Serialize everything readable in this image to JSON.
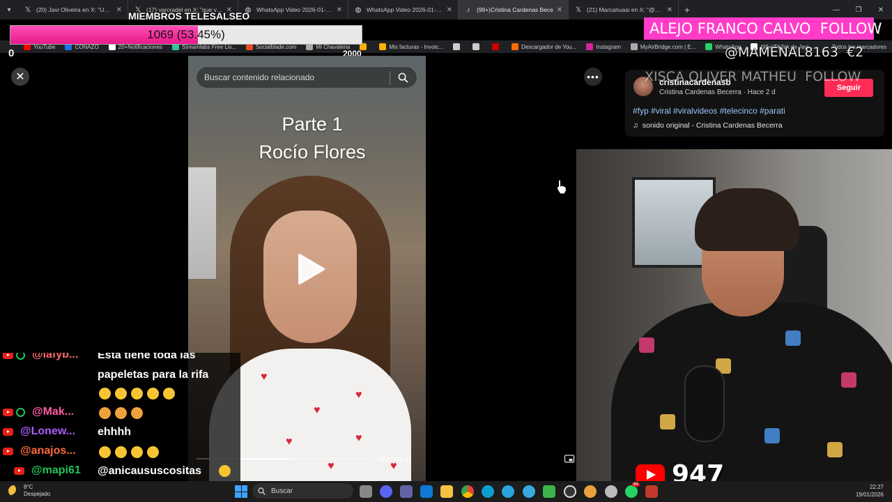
{
  "browser": {
    "tabs": [
      {
        "title": "(20) Javi Oliveira en X: \"Una de",
        "icon": "x-logo-icon",
        "active": false
      },
      {
        "title": "(17) varcradel en X: \"que van a",
        "icon": "x-logo-icon",
        "active": false
      },
      {
        "title": "WhatsApp Video 2026-01-18 a",
        "icon": "globe-icon",
        "active": false
      },
      {
        "title": "WhatsApp Video 2026-01-18 a",
        "icon": "globe-icon",
        "active": false
      },
      {
        "title": "(99+)Cristina Cardenas Bece",
        "icon": "tiktok-icon",
        "active": true
      },
      {
        "title": "(21) Marcahuasi en X: \"@Salom",
        "icon": "x-logo-icon",
        "active": false
      }
    ],
    "new_tab": "+",
    "bookmarks": [
      {
        "label": "YouTube",
        "color": "#ff0000"
      },
      {
        "label": "CONAZO",
        "color": "#1a73e8"
      },
      {
        "label": "20+Notificaciones",
        "color": "#ffffff"
      },
      {
        "label": "Streamlabs Free Liv...",
        "color": "#31c3a2"
      },
      {
        "label": "Socialblade.com",
        "color": "#e84a25"
      },
      {
        "label": "Mi Chavaleria",
        "color": "#aaaaaa"
      },
      {
        "label": "",
        "color": "#ffb000"
      },
      {
        "label": "Mis facturas - Invoic...",
        "color": "#ffb000"
      },
      {
        "label": "",
        "color": "#cccccc"
      },
      {
        "label": "",
        "color": "#cccccc"
      },
      {
        "label": "",
        "color": "#cc0000"
      },
      {
        "label": "Descargador de You...",
        "color": "#ff6a00"
      },
      {
        "label": "Instagram",
        "color": "#d6249f"
      },
      {
        "label": "MyAirBridge.com | E...",
        "color": "#aaaaaa"
      },
      {
        "label": "WhatsApp",
        "color": "#25d366"
      },
      {
        "label": "(99+)TikTok de Javi...",
        "color": "#ffffff"
      }
    ],
    "bookmarks_right": "Todos los marcadores"
  },
  "overlays": {
    "members_title": "MIEMBROS TELESALSEO",
    "goal_text": "1069 (53.45%)",
    "goal_fraction": 0.5345,
    "goal_min": "0",
    "goal_max": "2000",
    "follow_banner": "ALEJO FRANCO CALVO  FOLLOW",
    "tip_text": "@MAMENAL8163  €2",
    "follow_ghost": "XISCA OLIVER MATHEU  FOLLOW"
  },
  "tiktok": {
    "search_placeholder": "Buscar contenido relacionado",
    "title_line1": "Parte 1",
    "title_line2": "Rocío Flores",
    "timecode": "05:17/09:41",
    "progress_fraction": 0.55,
    "author_handle": "cristinacardenasb",
    "author_sub": "Cristina Cardenas Becerra · Hace 2 d",
    "follow_label": "Seguir",
    "hashtags": "#fyp #viral #viralvideos #telecinco #parati",
    "sound": "sonido original - Cristina Cardenas Becerra",
    "accent": "#fe2c55"
  },
  "chat": {
    "rows": [
      {
        "user": "@lafyb...",
        "text": "Esta tiene toda las",
        "color": "#ff6a6a",
        "sub": true
      },
      {
        "user": "",
        "text": "papeletas para la rifa",
        "color": "#ffffff",
        "sub": false
      },
      {
        "user": "@Mak...",
        "text": "",
        "color": "#ff5aa5",
        "sub": true
      },
      {
        "user": "@Lonew...",
        "text": "ehhhh",
        "color": "#b05cff",
        "sub": false
      },
      {
        "user": "@anajos...",
        "text": "",
        "color": "#ff6a3a",
        "sub": false
      },
      {
        "user": "@mapi61",
        "text": "@anicaususcositas",
        "color": "#22c35a",
        "sub": false
      }
    ]
  },
  "webcam": {
    "youtube_viewers": "947"
  },
  "taskbar": {
    "weather_temp": "8°C",
    "weather_desc": "Despejado",
    "search_label": "Buscar",
    "time": "22:27",
    "date": "19/01/2026",
    "whatsapp_badge": "84"
  }
}
